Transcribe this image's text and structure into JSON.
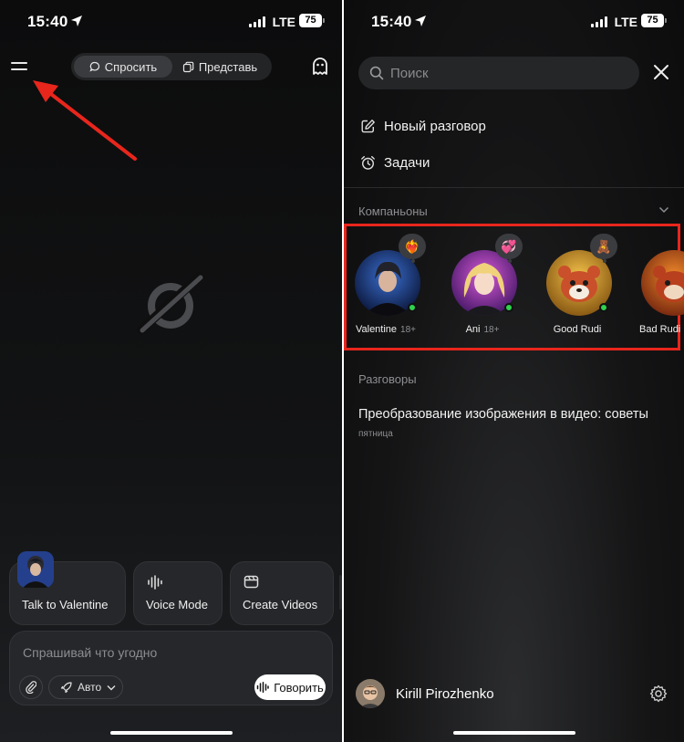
{
  "left_screen": {
    "status": {
      "time": "15:40",
      "network": "LTE",
      "battery": "75"
    },
    "header": {
      "tabs": [
        {
          "label": "Спросить",
          "active": true
        },
        {
          "label": "Представь",
          "active": false
        }
      ]
    },
    "suggestions": [
      {
        "label": "Talk to Valentine"
      },
      {
        "label": "Voice Mode"
      },
      {
        "label": "Create Videos"
      }
    ],
    "composer": {
      "placeholder": "Спрашивай что угодно",
      "mode": "Авто",
      "talk_label": "Говорить"
    }
  },
  "right_screen": {
    "status": {
      "time": "15:40",
      "network": "LTE",
      "battery": "75"
    },
    "search": {
      "placeholder": "Поиск"
    },
    "nav": [
      {
        "label": "Новый разговор",
        "icon": "edit-icon"
      },
      {
        "label": "Задачи",
        "icon": "alarm-clock-icon"
      }
    ],
    "companions_section": "Компаньоны",
    "companions": [
      {
        "name": "Valentine",
        "age": "18+",
        "badge": "❤️‍🔥",
        "online": true
      },
      {
        "name": "Ani",
        "age": "18+",
        "badge": "💞",
        "online": true
      },
      {
        "name": "Good Rudi",
        "age": "",
        "badge": "🧸",
        "online": true
      },
      {
        "name": "Bad Rudi",
        "age": "",
        "badge": "",
        "online": false
      }
    ],
    "conversations_section": "Разговоры",
    "conversations": [
      {
        "title": "Преобразование изображения в видео: советы",
        "date": "пятница"
      }
    ],
    "user": {
      "name": "Kirill Pirozhenko"
    }
  },
  "colors": {
    "annotation_red": "#e8261c",
    "online_green": "#2fd24e",
    "background": "#0c0c0d"
  }
}
